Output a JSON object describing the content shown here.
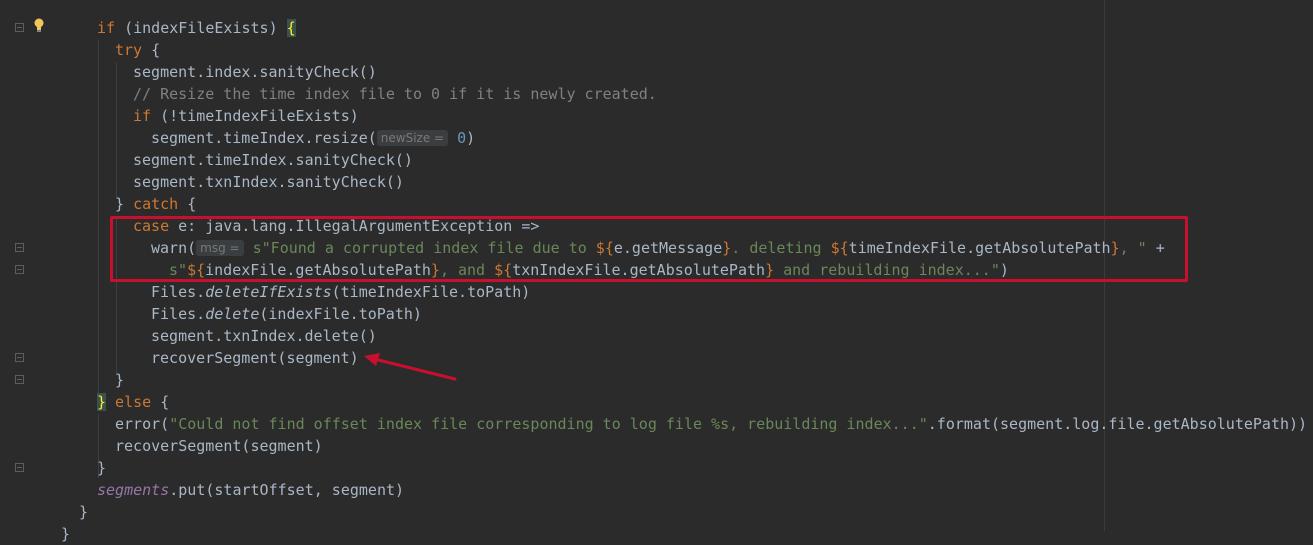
{
  "code": {
    "l1": {
      "kw": "if",
      "rest": " (indexFileExists) ",
      "brace": "{"
    },
    "l2": {
      "kw": "try",
      "rest": " {"
    },
    "l3": {
      "text": "segment.index.sanityCheck()"
    },
    "l4": {
      "comment": "// Resize the time index file to 0 if it is newly created."
    },
    "l5": {
      "kw": "if",
      "rest": " (!timeIndexFileExists)"
    },
    "l6": {
      "pre": "segment.timeIndex.resize(",
      "hint": "newSize =",
      "num": "0",
      "post": ")"
    },
    "l7": {
      "text": "segment.timeIndex.sanityCheck()"
    },
    "l8": {
      "text": "segment.txnIndex.sanityCheck()"
    },
    "l9": {
      "pre": "} ",
      "kw": "catch",
      "post": " {"
    },
    "l10": {
      "kw": "case",
      "rest": " e: java.lang.IllegalArgumentException =>"
    },
    "l11": {
      "pre": "warn(",
      "hint": "msg =",
      "s1": "s\"Found a corrupted index file due to ",
      "i1o": "${",
      "i1": "e.getMessage",
      "i1c": "}",
      "s2": ". deleting ",
      "i2o": "${",
      "i2": "timeIndexFile.getAbsolutePath",
      "i2c": "}",
      "s3": ", \"",
      "post": " +"
    },
    "l12": {
      "s1": "s\"",
      "i1o": "${",
      "i1": "indexFile.getAbsolutePath",
      "i1c": "}",
      "s2": ", and ",
      "i2o": "${",
      "i2": "txnIndexFile.getAbsolutePath",
      "i2c": "}",
      "s3": " and rebuilding index...\"",
      "post": ")"
    },
    "l13": {
      "pre": "Files.",
      "it": "deleteIfExists",
      "post": "(timeIndexFile.toPath)"
    },
    "l14": {
      "pre": "Files.",
      "it": "delete",
      "post": "(indexFile.toPath)"
    },
    "l15": {
      "text": "segment.txnIndex.delete()"
    },
    "l16": {
      "text": "recoverSegment(segment)"
    },
    "l17": {
      "text": "}"
    },
    "l18": {
      "brace": "}",
      "kw": " else",
      "post": " {"
    },
    "l19": {
      "pre": "error(",
      "str": "\"Could not find offset index file corresponding to log file %s, rebuilding index...\"",
      "post": ".format(segment.log.file.getAbsolutePath))"
    },
    "l20": {
      "text": "recoverSegment(segment)"
    },
    "l21": {
      "text": "}"
    },
    "l22": {
      "field": "segments",
      "post": ".put(startOffset, segment)"
    },
    "l23": {
      "text": "}"
    },
    "l24": {
      "text": "}"
    }
  },
  "colors": {
    "background": "#2b2b2b",
    "keyword": "#cc7832",
    "string": "#6a8759",
    "comment": "#808080",
    "number": "#6897bb",
    "field": "#9876aa",
    "text": "#a9b7c6",
    "highlight_box": "#c8102e"
  },
  "icons": {
    "intention": "lightbulb-icon",
    "fold": "fold-marker-icon",
    "annotation": "red-arrow"
  }
}
